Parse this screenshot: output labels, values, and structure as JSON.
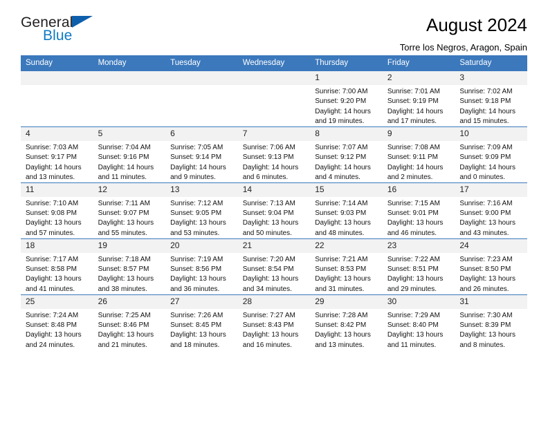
{
  "brand": {
    "name_part1": "General",
    "name_part2": "Blue",
    "flag_color": "#0e5fab",
    "blue_color": "#0e7ac4"
  },
  "header": {
    "title": "August 2024",
    "subtitle": "Torre los Negros, Aragon, Spain"
  },
  "theme": {
    "header_bg": "#3b78bc",
    "cell_header_bg": "#f2f2f2",
    "cell_bg": "#ffffff",
    "text": "#000000"
  },
  "weekdays": [
    "Sunday",
    "Monday",
    "Tuesday",
    "Wednesday",
    "Thursday",
    "Friday",
    "Saturday"
  ],
  "labels": {
    "sunrise_prefix": "Sunrise:",
    "sunset_prefix": "Sunset:",
    "daylight_prefix": "Daylight:"
  },
  "weeks": [
    [
      {
        "day": "",
        "empty": true
      },
      {
        "day": "",
        "empty": true
      },
      {
        "day": "",
        "empty": true
      },
      {
        "day": "",
        "empty": true
      },
      {
        "day": "1",
        "sunrise": "Sunrise: 7:00 AM",
        "sunset": "Sunset: 9:20 PM",
        "daylight_1": "Daylight: 14 hours",
        "daylight_2": "and 19 minutes."
      },
      {
        "day": "2",
        "sunrise": "Sunrise: 7:01 AM",
        "sunset": "Sunset: 9:19 PM",
        "daylight_1": "Daylight: 14 hours",
        "daylight_2": "and 17 minutes."
      },
      {
        "day": "3",
        "sunrise": "Sunrise: 7:02 AM",
        "sunset": "Sunset: 9:18 PM",
        "daylight_1": "Daylight: 14 hours",
        "daylight_2": "and 15 minutes."
      }
    ],
    [
      {
        "day": "4",
        "sunrise": "Sunrise: 7:03 AM",
        "sunset": "Sunset: 9:17 PM",
        "daylight_1": "Daylight: 14 hours",
        "daylight_2": "and 13 minutes."
      },
      {
        "day": "5",
        "sunrise": "Sunrise: 7:04 AM",
        "sunset": "Sunset: 9:16 PM",
        "daylight_1": "Daylight: 14 hours",
        "daylight_2": "and 11 minutes."
      },
      {
        "day": "6",
        "sunrise": "Sunrise: 7:05 AM",
        "sunset": "Sunset: 9:14 PM",
        "daylight_1": "Daylight: 14 hours",
        "daylight_2": "and 9 minutes."
      },
      {
        "day": "7",
        "sunrise": "Sunrise: 7:06 AM",
        "sunset": "Sunset: 9:13 PM",
        "daylight_1": "Daylight: 14 hours",
        "daylight_2": "and 6 minutes."
      },
      {
        "day": "8",
        "sunrise": "Sunrise: 7:07 AM",
        "sunset": "Sunset: 9:12 PM",
        "daylight_1": "Daylight: 14 hours",
        "daylight_2": "and 4 minutes."
      },
      {
        "day": "9",
        "sunrise": "Sunrise: 7:08 AM",
        "sunset": "Sunset: 9:11 PM",
        "daylight_1": "Daylight: 14 hours",
        "daylight_2": "and 2 minutes."
      },
      {
        "day": "10",
        "sunrise": "Sunrise: 7:09 AM",
        "sunset": "Sunset: 9:09 PM",
        "daylight_1": "Daylight: 14 hours",
        "daylight_2": "and 0 minutes."
      }
    ],
    [
      {
        "day": "11",
        "sunrise": "Sunrise: 7:10 AM",
        "sunset": "Sunset: 9:08 PM",
        "daylight_1": "Daylight: 13 hours",
        "daylight_2": "and 57 minutes."
      },
      {
        "day": "12",
        "sunrise": "Sunrise: 7:11 AM",
        "sunset": "Sunset: 9:07 PM",
        "daylight_1": "Daylight: 13 hours",
        "daylight_2": "and 55 minutes."
      },
      {
        "day": "13",
        "sunrise": "Sunrise: 7:12 AM",
        "sunset": "Sunset: 9:05 PM",
        "daylight_1": "Daylight: 13 hours",
        "daylight_2": "and 53 minutes."
      },
      {
        "day": "14",
        "sunrise": "Sunrise: 7:13 AM",
        "sunset": "Sunset: 9:04 PM",
        "daylight_1": "Daylight: 13 hours",
        "daylight_2": "and 50 minutes."
      },
      {
        "day": "15",
        "sunrise": "Sunrise: 7:14 AM",
        "sunset": "Sunset: 9:03 PM",
        "daylight_1": "Daylight: 13 hours",
        "daylight_2": "and 48 minutes."
      },
      {
        "day": "16",
        "sunrise": "Sunrise: 7:15 AM",
        "sunset": "Sunset: 9:01 PM",
        "daylight_1": "Daylight: 13 hours",
        "daylight_2": "and 46 minutes."
      },
      {
        "day": "17",
        "sunrise": "Sunrise: 7:16 AM",
        "sunset": "Sunset: 9:00 PM",
        "daylight_1": "Daylight: 13 hours",
        "daylight_2": "and 43 minutes."
      }
    ],
    [
      {
        "day": "18",
        "sunrise": "Sunrise: 7:17 AM",
        "sunset": "Sunset: 8:58 PM",
        "daylight_1": "Daylight: 13 hours",
        "daylight_2": "and 41 minutes."
      },
      {
        "day": "19",
        "sunrise": "Sunrise: 7:18 AM",
        "sunset": "Sunset: 8:57 PM",
        "daylight_1": "Daylight: 13 hours",
        "daylight_2": "and 38 minutes."
      },
      {
        "day": "20",
        "sunrise": "Sunrise: 7:19 AM",
        "sunset": "Sunset: 8:56 PM",
        "daylight_1": "Daylight: 13 hours",
        "daylight_2": "and 36 minutes."
      },
      {
        "day": "21",
        "sunrise": "Sunrise: 7:20 AM",
        "sunset": "Sunset: 8:54 PM",
        "daylight_1": "Daylight: 13 hours",
        "daylight_2": "and 34 minutes."
      },
      {
        "day": "22",
        "sunrise": "Sunrise: 7:21 AM",
        "sunset": "Sunset: 8:53 PM",
        "daylight_1": "Daylight: 13 hours",
        "daylight_2": "and 31 minutes."
      },
      {
        "day": "23",
        "sunrise": "Sunrise: 7:22 AM",
        "sunset": "Sunset: 8:51 PM",
        "daylight_1": "Daylight: 13 hours",
        "daylight_2": "and 29 minutes."
      },
      {
        "day": "24",
        "sunrise": "Sunrise: 7:23 AM",
        "sunset": "Sunset: 8:50 PM",
        "daylight_1": "Daylight: 13 hours",
        "daylight_2": "and 26 minutes."
      }
    ],
    [
      {
        "day": "25",
        "sunrise": "Sunrise: 7:24 AM",
        "sunset": "Sunset: 8:48 PM",
        "daylight_1": "Daylight: 13 hours",
        "daylight_2": "and 24 minutes."
      },
      {
        "day": "26",
        "sunrise": "Sunrise: 7:25 AM",
        "sunset": "Sunset: 8:46 PM",
        "daylight_1": "Daylight: 13 hours",
        "daylight_2": "and 21 minutes."
      },
      {
        "day": "27",
        "sunrise": "Sunrise: 7:26 AM",
        "sunset": "Sunset: 8:45 PM",
        "daylight_1": "Daylight: 13 hours",
        "daylight_2": "and 18 minutes."
      },
      {
        "day": "28",
        "sunrise": "Sunrise: 7:27 AM",
        "sunset": "Sunset: 8:43 PM",
        "daylight_1": "Daylight: 13 hours",
        "daylight_2": "and 16 minutes."
      },
      {
        "day": "29",
        "sunrise": "Sunrise: 7:28 AM",
        "sunset": "Sunset: 8:42 PM",
        "daylight_1": "Daylight: 13 hours",
        "daylight_2": "and 13 minutes."
      },
      {
        "day": "30",
        "sunrise": "Sunrise: 7:29 AM",
        "sunset": "Sunset: 8:40 PM",
        "daylight_1": "Daylight: 13 hours",
        "daylight_2": "and 11 minutes."
      },
      {
        "day": "31",
        "sunrise": "Sunrise: 7:30 AM",
        "sunset": "Sunset: 8:39 PM",
        "daylight_1": "Daylight: 13 hours",
        "daylight_2": "and 8 minutes."
      }
    ]
  ]
}
